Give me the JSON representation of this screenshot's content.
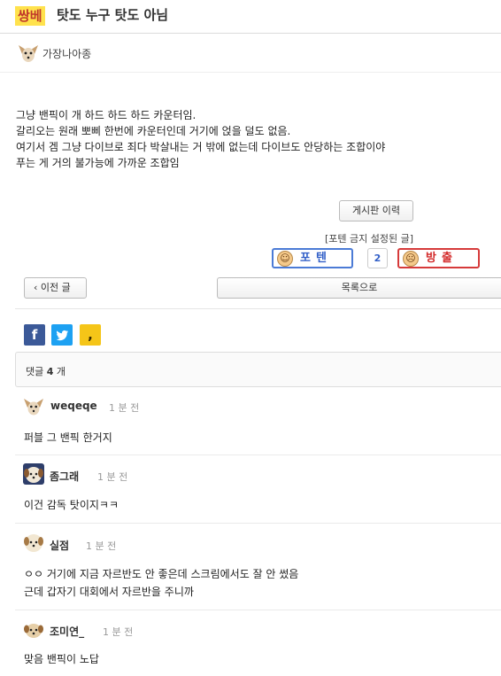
{
  "post": {
    "category": "쌍베",
    "title": "탓도 누구 탓도 아님",
    "author": "가장나아종",
    "body": [
      "그냥 밴픽이 개 하드 하드 하드 카운터임.",
      "갈리오는 원래 뽀삐 한번에 카운터인데 거기에 얹을 덜도 없음.",
      "여기서 겜 그냥 다이브로 죄다 박살내는 거 밖에 없는데 다이브도 안당하는 조합이야",
      "푸는 게 거의 불가능에 가까운 조합임"
    ]
  },
  "actions": {
    "history_label": "게시판 이력",
    "vote_note": "[포텐 금지 설정된 글]",
    "vote_up_label": "포텐",
    "vote_count": "2",
    "vote_down_label": "방출",
    "prev_label": "이전 글",
    "list_label": "목록으로"
  },
  "share": {
    "facebook_glyph": "f",
    "twitter_glyph": "t",
    "kakaostory_glyph": ","
  },
  "comments_header": {
    "prefix": "댓글 ",
    "count": "4",
    "suffix": " 개"
  },
  "comments": [
    {
      "nick": "weqeqe",
      "time": "1 분 전",
      "lines": [
        "퍼블 그 밴픽 한거지"
      ]
    },
    {
      "nick": "좀그래",
      "time": "1 분 전",
      "lines": [
        "이건 감독 탓이지ㅋㅋ"
      ]
    },
    {
      "nick": "실점",
      "time": "1 분 전",
      "lines": [
        "ㅇㅇ 거기에 지금 자르반도 안 좋은데 스크림에서도 잘 안 썼음",
        "근데 갑자기 대회에서 자르반을 주니까"
      ]
    },
    {
      "nick": "조미연_",
      "time": "1 분 전",
      "lines": [
        "맞음 밴픽이 노답"
      ]
    }
  ],
  "colors": {
    "category_bg": "#ffe24d",
    "vote_up": "#3360c8",
    "vote_down": "#d32b2b",
    "facebook": "#3b5998",
    "twitter": "#1da1f2",
    "kakaostory": "#f5c518"
  }
}
